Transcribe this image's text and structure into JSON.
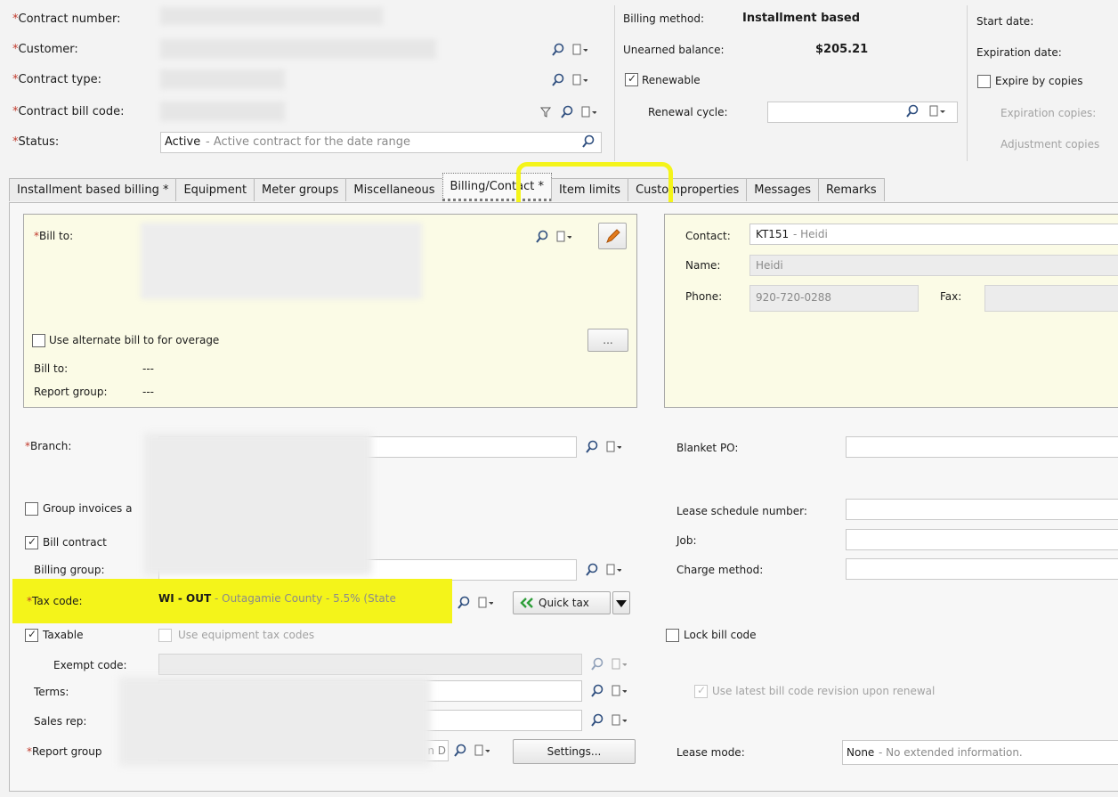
{
  "header": {
    "contract_number_label": "*Contract number:",
    "customer_label": "*Customer:",
    "contract_type_label": "*Contract type:",
    "contract_bill_code_label": "*Contract bill code:",
    "status_label": "*Status:",
    "status_value": "Active",
    "status_desc": " - Active contract for the date range",
    "billing_method_label": "Billing method:",
    "billing_method_value": "Installment based",
    "unearned_balance_label": "Unearned balance:",
    "unearned_balance_value": "$205.21",
    "renewable_label": "Renewable",
    "renewal_cycle_label": "Renewal cycle:",
    "start_date_label": "Start date:",
    "expiration_date_label": "Expiration date:",
    "expire_by_copies_label": "Expire by copies",
    "expiration_copies_label": "Expiration copies:",
    "adjustment_copies_label": "Adjustment copies"
  },
  "tabs": [
    {
      "label": "Installment based billing *"
    },
    {
      "label": "Equipment"
    },
    {
      "label": "Meter groups"
    },
    {
      "label": "Miscellaneous"
    },
    {
      "label": "Billing/Contact *"
    },
    {
      "label": "Item limits"
    },
    {
      "label": "Customproperties"
    },
    {
      "label": "Messages"
    },
    {
      "label": "Remarks"
    }
  ],
  "billing_panel": {
    "bill_to_label": "*Bill to:",
    "use_alternate_label": "Use alternate bill to for overage",
    "ellipsis_label": "...",
    "bill_to2_label": "Bill to:",
    "bill_to2_value": "---",
    "report_group_label": "Report group:",
    "report_group_value": "---"
  },
  "contact_panel": {
    "contact_label": "Contact:",
    "contact_code": "KT151",
    "contact_name": " - Heidi",
    "name_label": "Name:",
    "name_value": "Heidi",
    "phone_label": "Phone:",
    "phone_value": "920-720-0288",
    "fax_label": "Fax:"
  },
  "form": {
    "branch_label": "*Branch:",
    "group_invoices_label": "Group invoices a",
    "bill_contract_label": "Bill contract",
    "billing_group_label": "Billing group:",
    "tax_code_label": "*Tax code:",
    "tax_code_value": "WI - OUT",
    "tax_code_desc": " - Outagamie County - 5.5% (State",
    "quick_tax_label": "Quick tax",
    "taxable_label": "Taxable",
    "use_equipment_tax_label": "Use equipment tax codes",
    "exempt_code_label": "Exempt code:",
    "terms_label": "Terms:",
    "sales_rep_label": "Sales rep:",
    "report_group_label": "*Report group",
    "report_group_tail": "n D",
    "settings_label": "Settings...",
    "blanket_po_label": "Blanket PO:",
    "lease_schedule_label": "Lease schedule number:",
    "job_label": "Job:",
    "charge_method_label": "Charge method:",
    "lock_bill_code_label": "Lock bill code",
    "use_latest_label": "Use latest bill code revision upon renewal",
    "lease_mode_label": "Lease mode:",
    "lease_mode_value": "None",
    "lease_mode_desc": " - No extended information."
  },
  "colors": {
    "highlight": "#f4f41a",
    "panel_bg": "#fbfbe6",
    "required": "#c0392b",
    "quick_tax_arrow": "#2e9e3a"
  }
}
